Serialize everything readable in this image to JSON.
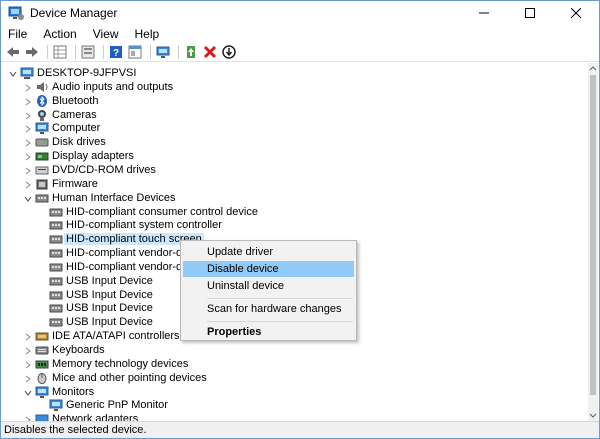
{
  "window": {
    "title": "Device Manager"
  },
  "menubar": [
    "File",
    "Action",
    "View",
    "Help"
  ],
  "toolbar_icons": [
    "back-icon",
    "forward-icon",
    "properties-grid-icon",
    "show-hidden-icon",
    "help-icon",
    "device-view-icon",
    "scan-hardware-icon",
    "update-driver-icon",
    "uninstall-icon",
    "disable-icon"
  ],
  "tree": [
    {
      "label": "DESKTOP-9JFPVSI",
      "level": 0,
      "state": "expanded",
      "icon": "computer-icon"
    },
    {
      "label": "Audio inputs and outputs",
      "level": 1,
      "state": "collapsed",
      "icon": "speaker-icon"
    },
    {
      "label": "Bluetooth",
      "level": 1,
      "state": "collapsed",
      "icon": "bluetooth-icon"
    },
    {
      "label": "Cameras",
      "level": 1,
      "state": "collapsed",
      "icon": "camera-icon"
    },
    {
      "label": "Computer",
      "level": 1,
      "state": "collapsed",
      "icon": "monitor-icon"
    },
    {
      "label": "Disk drives",
      "level": 1,
      "state": "collapsed",
      "icon": "disk-icon"
    },
    {
      "label": "Display adapters",
      "level": 1,
      "state": "collapsed",
      "icon": "display-adapter-icon"
    },
    {
      "label": "DVD/CD-ROM drives",
      "level": 1,
      "state": "collapsed",
      "icon": "dvd-icon"
    },
    {
      "label": "Firmware",
      "level": 1,
      "state": "collapsed",
      "icon": "firmware-icon"
    },
    {
      "label": "Human Interface Devices",
      "level": 1,
      "state": "expanded",
      "icon": "hid-icon"
    },
    {
      "label": "HID-compliant consumer control device",
      "level": 2,
      "state": "leaf",
      "icon": "hid-icon"
    },
    {
      "label": "HID-compliant system controller",
      "level": 2,
      "state": "leaf",
      "icon": "hid-icon"
    },
    {
      "label": "HID-compliant touch screen",
      "level": 2,
      "state": "leaf",
      "icon": "hid-icon",
      "highlighted": true
    },
    {
      "label": "HID-compliant vendor-defin",
      "level": 2,
      "state": "leaf",
      "icon": "hid-icon"
    },
    {
      "label": "HID-compliant vendor-defin",
      "level": 2,
      "state": "leaf",
      "icon": "hid-icon"
    },
    {
      "label": "USB Input Device",
      "level": 2,
      "state": "leaf",
      "icon": "hid-icon"
    },
    {
      "label": "USB Input Device",
      "level": 2,
      "state": "leaf",
      "icon": "hid-icon"
    },
    {
      "label": "USB Input Device",
      "level": 2,
      "state": "leaf",
      "icon": "hid-icon"
    },
    {
      "label": "USB Input Device",
      "level": 2,
      "state": "leaf",
      "icon": "hid-icon"
    },
    {
      "label": "IDE ATA/ATAPI controllers",
      "level": 1,
      "state": "collapsed",
      "icon": "ide-icon"
    },
    {
      "label": "Keyboards",
      "level": 1,
      "state": "collapsed",
      "icon": "keyboard-icon"
    },
    {
      "label": "Memory technology devices",
      "level": 1,
      "state": "collapsed",
      "icon": "memory-icon"
    },
    {
      "label": "Mice and other pointing devices",
      "level": 1,
      "state": "collapsed",
      "icon": "mouse-icon"
    },
    {
      "label": "Monitors",
      "level": 1,
      "state": "expanded",
      "icon": "monitor-icon"
    },
    {
      "label": "Generic PnP Monitor",
      "level": 2,
      "state": "leaf",
      "icon": "monitor-icon"
    },
    {
      "label": "Network adapters",
      "level": 1,
      "state": "collapsed",
      "icon": "network-icon"
    }
  ],
  "context_menu": [
    {
      "label": "Update driver",
      "type": "item"
    },
    {
      "label": "Disable device",
      "type": "item",
      "hovered": true
    },
    {
      "label": "Uninstall device",
      "type": "item"
    },
    {
      "type": "separator"
    },
    {
      "label": "Scan for hardware changes",
      "type": "item"
    },
    {
      "type": "separator"
    },
    {
      "label": "Properties",
      "type": "item",
      "bold": true
    }
  ],
  "statusbar": {
    "text": "Disables the selected device."
  },
  "colors": {
    "accent": "#0078d7",
    "highlight": "#cce8ff",
    "menu_hover": "#91c9f7"
  }
}
